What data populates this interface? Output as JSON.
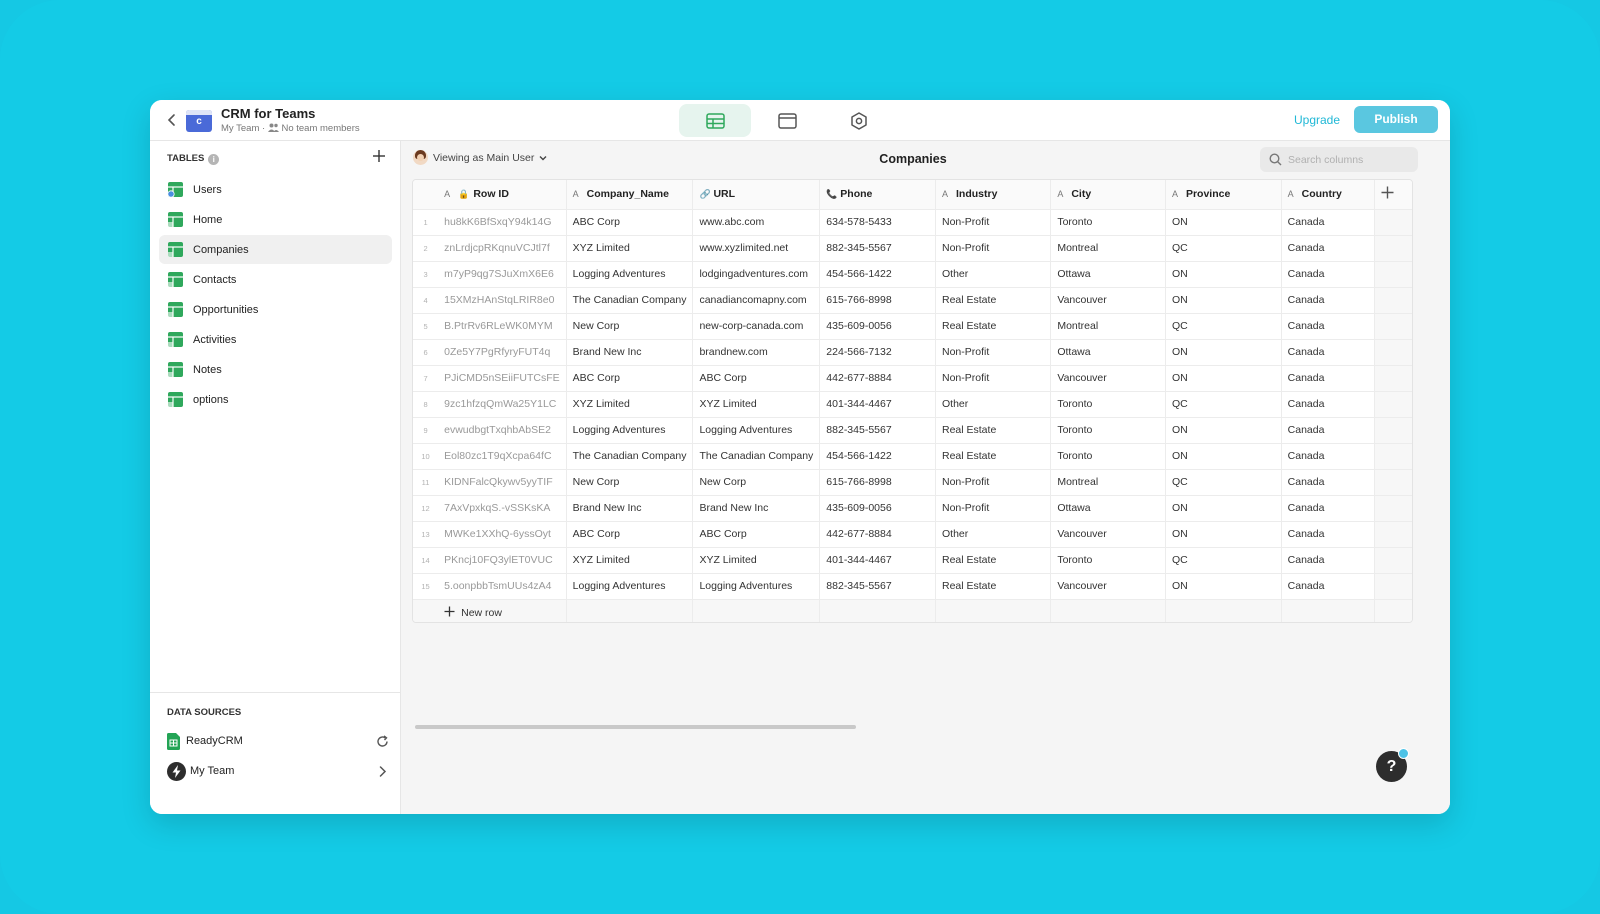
{
  "app": {
    "icon_letter": "c",
    "title": "CRM for Teams",
    "team": "My Team",
    "members": "No team members",
    "upgrade_label": "Upgrade",
    "publish_label": "Publish"
  },
  "sidebar": {
    "tables_heading": "TABLES",
    "items": [
      {
        "label": "Users"
      },
      {
        "label": "Home"
      },
      {
        "label": "Companies"
      },
      {
        "label": "Contacts"
      },
      {
        "label": "Opportunities"
      },
      {
        "label": "Activities"
      },
      {
        "label": "Notes"
      },
      {
        "label": "options"
      }
    ],
    "active_index": 2,
    "data_sources_heading": "DATA SOURCES",
    "data_sources": [
      {
        "label": "ReadyCRM"
      },
      {
        "label": "My Team"
      }
    ]
  },
  "main": {
    "viewing_prefix": "Viewing as",
    "viewing_user": "Main User",
    "title": "Companies",
    "search_placeholder": "Search columns"
  },
  "table": {
    "columns": [
      "Row ID",
      "Company_Name",
      "URL",
      "Phone",
      "Industry",
      "City",
      "Province",
      "Country"
    ],
    "rows": [
      {
        "n": "1",
        "id": "hu8kK6BfSxqY94k14G",
        "company": "ABC Corp",
        "url": "www.abc.com",
        "phone": "634-578-5433",
        "industry": "Non-Profit",
        "city": "Toronto",
        "province": "ON",
        "country": "Canada"
      },
      {
        "n": "2",
        "id": "znLrdjcpRKqnuVCJtl7f",
        "company": "XYZ Limited",
        "url": "www.xyzlimited.net",
        "phone": "882-345-5567",
        "industry": "Non-Profit",
        "city": "Montreal",
        "province": "QC",
        "country": "Canada"
      },
      {
        "n": "3",
        "id": "m7yP9qg7SJuXmX6E6",
        "company": "Logging Adventures",
        "url": "lodgingadventures.com",
        "phone": "454-566-1422",
        "industry": "Other",
        "city": "Ottawa",
        "province": "ON",
        "country": "Canada"
      },
      {
        "n": "4",
        "id": "15XMzHAnStqLRIR8e0",
        "company": "The Canadian Company",
        "url": "canadiancomapny.com",
        "phone": "615-766-8998",
        "industry": "Real Estate",
        "city": "Vancouver",
        "province": "ON",
        "country": "Canada"
      },
      {
        "n": "5",
        "id": "B.PtrRv6RLeWK0MYM",
        "company": "New Corp",
        "url": "new-corp-canada.com",
        "phone": "435-609-0056",
        "industry": "Real Estate",
        "city": "Montreal",
        "province": "QC",
        "country": "Canada"
      },
      {
        "n": "6",
        "id": "0Ze5Y7PgRfyryFUT4q",
        "company": "Brand New Inc",
        "url": "brandnew.com",
        "phone": "224-566-7132",
        "industry": "Non-Profit",
        "city": "Ottawa",
        "province": "ON",
        "country": "Canada"
      },
      {
        "n": "7",
        "id": "PJiCMD5nSEiiFUTCsFE",
        "company": "ABC Corp",
        "url": "ABC Corp",
        "phone": "442-677-8884",
        "industry": "Non-Profit",
        "city": "Vancouver",
        "province": "ON",
        "country": "Canada"
      },
      {
        "n": "8",
        "id": "9zc1hfzqQmWa25Y1LC",
        "company": "XYZ Limited",
        "url": "XYZ Limited",
        "phone": "401-344-4467",
        "industry": "Other",
        "city": "Toronto",
        "province": "QC",
        "country": "Canada"
      },
      {
        "n": "9",
        "id": "evwudbgtTxqhbAbSE2",
        "company": "Logging Adventures",
        "url": "Logging Adventures",
        "phone": "882-345-5567",
        "industry": "Real Estate",
        "city": "Toronto",
        "province": "ON",
        "country": "Canada"
      },
      {
        "n": "10",
        "id": "Eol80zc1T9qXcpa64fC",
        "company": "The Canadian Company",
        "url": "The Canadian Company",
        "phone": "454-566-1422",
        "industry": "Real Estate",
        "city": "Toronto",
        "province": "ON",
        "country": "Canada"
      },
      {
        "n": "11",
        "id": "KIDNFalcQkywv5yyTIF",
        "company": "New Corp",
        "url": "New Corp",
        "phone": "615-766-8998",
        "industry": "Non-Profit",
        "city": "Montreal",
        "province": "QC",
        "country": "Canada"
      },
      {
        "n": "12",
        "id": "7AxVpxkqS.-vSSKsKA",
        "company": "Brand New Inc",
        "url": "Brand New Inc",
        "phone": "435-609-0056",
        "industry": "Non-Profit",
        "city": "Ottawa",
        "province": "ON",
        "country": "Canada"
      },
      {
        "n": "13",
        "id": "MWKe1XXhQ-6yssOyt",
        "company": "ABC Corp",
        "url": "ABC Corp",
        "phone": "442-677-8884",
        "industry": "Other",
        "city": "Vancouver",
        "province": "ON",
        "country": "Canada"
      },
      {
        "n": "14",
        "id": "PKncj10FQ3ylET0VUC",
        "company": "XYZ Limited",
        "url": "XYZ Limited",
        "phone": "401-344-4467",
        "industry": "Real Estate",
        "city": "Toronto",
        "province": "QC",
        "country": "Canada"
      },
      {
        "n": "15",
        "id": "5.oonpbbTsmUUs4zA4",
        "company": "Logging Adventures",
        "url": "Logging Adventures",
        "phone": "882-345-5567",
        "industry": "Real Estate",
        "city": "Vancouver",
        "province": "ON",
        "country": "Canada"
      }
    ],
    "new_row_label": "New row"
  },
  "help": {
    "label": "?"
  },
  "colors": {
    "background": "#14cbe6",
    "accent": "#20b8d6",
    "publish": "#5ac7e0",
    "table_icon": "#2fa85c",
    "app_icon": "#4a6ad8"
  }
}
